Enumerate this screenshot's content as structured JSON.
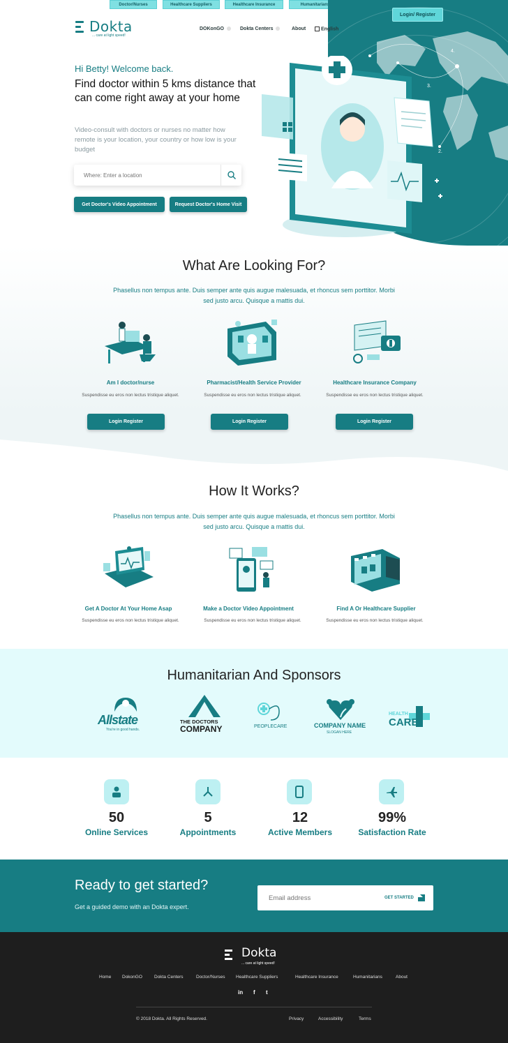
{
  "top_tabs": [
    "Doctor/Nurses",
    "Healthcare Suppliers",
    "Healthcare Insurance",
    "Humanitarians"
  ],
  "header": {
    "login_label": "Login/ Register",
    "logo_name": "Dokta",
    "logo_tag": "... care at light speed!",
    "nav": [
      "DOKonGO",
      "Dokta Centers",
      "About",
      "English"
    ]
  },
  "hero": {
    "greeting": "Hi Betty! Welcome back.",
    "title": "Find doctor within 5 kms distance that can come right away at your home",
    "subtitle": "Video-consult with doctors or nurses no matter how remote is your location, your country or how low is your budget",
    "search_placeholder": "Where: Enter a location",
    "btn_video": "Get Doctor's Video Appointment",
    "btn_home": "Request Doctor's Home Visit",
    "map_labels": [
      "4.",
      "3.",
      "2."
    ]
  },
  "looking": {
    "title": "What Are Looking For?",
    "subtitle": "Phasellus non tempus ante. Duis semper ante quis augue malesuada, et rhoncus sem porttitor. Morbi sed justo arcu. Quisque a mattis dui.",
    "cards": [
      {
        "title": "Am I doctor/nurse",
        "text": "Suspendisse eu eros non lectus tristique aliquet.",
        "button": "Login Register"
      },
      {
        "title": "Pharmacist/Health Service Provider",
        "text": "Suspendisse eu eros non lectus tristique aliquet.",
        "button": "Login Register"
      },
      {
        "title": "Healthcare Insurance Company",
        "text": "Suspendisse eu eros non lectus tristique aliquet.",
        "button": "Login Register"
      }
    ]
  },
  "how": {
    "title": "How It Works?",
    "subtitle": "Phasellus non tempus ante. Duis semper ante quis augue malesuada, et rhoncus sem porttitor. Morbi sed justo arcu. Quisque a mattis dui.",
    "cards": [
      {
        "title": "Get A Doctor At Your Home Asap",
        "text": "Suspendisse eu eros non lectus tristique aliquet."
      },
      {
        "title": "Make a Doctor Video Appointment",
        "text": "Suspendisse eu eros non lectus tristique aliquet."
      },
      {
        "title": "Find A Or Healthcare Supplier",
        "text": "Suspendisse eu eros non lectus tristique aliquet."
      }
    ]
  },
  "sponsors": {
    "title": "Humanitarian And Sponsors",
    "allstate": "Allstate",
    "allstate_tag": "You're in good hands.",
    "doctors_line1": "THE DOCTORS",
    "doctors_line2": "COMPANY",
    "peoplecare": "PEOPLECARE",
    "company_name": "COMPANY NAME",
    "company_slogan": "SLOGAN HERE",
    "healthcare_line1": "HEALTH",
    "healthcare_line2": "CARE"
  },
  "stats": [
    {
      "num": "50",
      "label": "Online Services"
    },
    {
      "num": "5",
      "label": "Appointments"
    },
    {
      "num": "12",
      "label": "Active Members"
    },
    {
      "num": "99%",
      "label": "Satisfaction Rate"
    }
  ],
  "cta": {
    "title": "Ready to get started?",
    "subtitle": "Get a guided demo with an Dokta expert.",
    "email_placeholder": "Email address",
    "button": "GET STARTED"
  },
  "footer": {
    "logo_name": "Dokta",
    "logo_tag": "... care at light speed!",
    "links": [
      "Home",
      "DokonGO",
      "Dokta Centers",
      "Doctor/Nurses",
      "Healthcare Suppliers",
      "Healthcare Insurance",
      "Humanitarians",
      "About"
    ],
    "social": [
      "in",
      "f",
      "t"
    ],
    "copyright": "© 2018 Dokta. All Rights Reserved.",
    "legal": [
      "Privacy",
      "Accessibility",
      "Terms"
    ]
  },
  "colors": {
    "primary": "#177d83",
    "accent": "#5fd6d9",
    "light": "#e3fbfc",
    "footer": "#1e1e1e"
  }
}
